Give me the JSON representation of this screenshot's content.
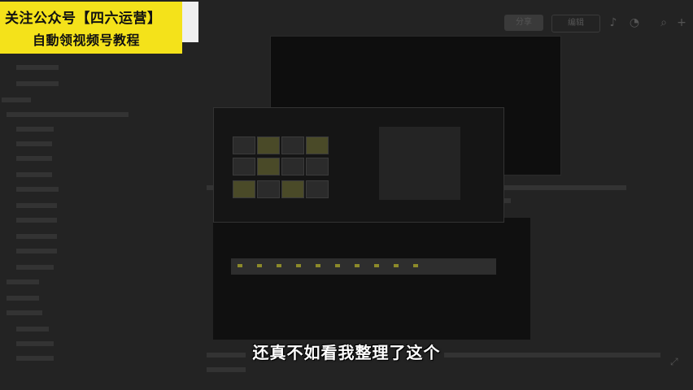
{
  "banner": {
    "line1": "关注公众号【四六运营】",
    "line2": "自動领视频号教程"
  },
  "toolbar": {
    "share_label": "分享",
    "edit_label": "编辑",
    "icons": [
      "bell-icon",
      "user-icon",
      "search-icon",
      "plus-icon"
    ]
  },
  "subtitle": "还真不如看我整理了这个"
}
